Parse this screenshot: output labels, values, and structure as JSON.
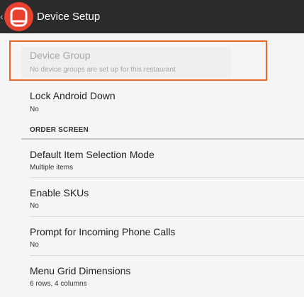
{
  "app": {
    "title": "Device Setup",
    "back_glyph": "‹",
    "icon": "restaurant-app-icon",
    "colors": {
      "topbar": "#2b2b2b",
      "brand": "#e8412f",
      "highlight": "#e8692a"
    }
  },
  "settings": {
    "device_group": {
      "title": "Device Group",
      "summary": "No device groups are set up for this restaurant"
    },
    "lock_android": {
      "title": "Lock Android Down",
      "summary": "No"
    },
    "order_screen_header": "ORDER SCREEN",
    "default_selection": {
      "title": "Default Item Selection Mode",
      "summary": "Multiple items"
    },
    "enable_skus": {
      "title": "Enable SKUs",
      "summary": "No"
    },
    "prompt_calls": {
      "title": "Prompt for Incoming Phone Calls",
      "summary": "No"
    },
    "menu_grid": {
      "title": "Menu Grid Dimensions",
      "summary": "6 rows, 4 columns"
    }
  }
}
